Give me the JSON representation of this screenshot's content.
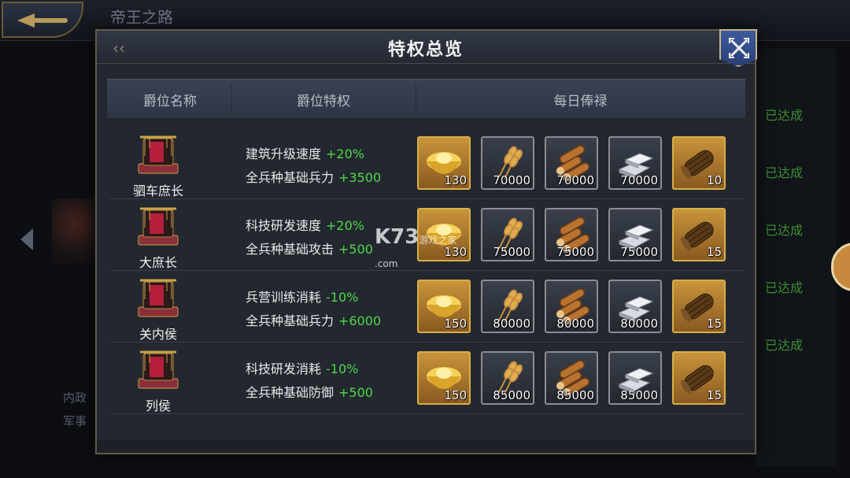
{
  "background": {
    "page_title": "帝王之路",
    "achieved_label": "已达成",
    "left_text_1": "内政",
    "left_text_2": "军事"
  },
  "dialog": {
    "title": "特权总览",
    "headers": [
      "爵位名称",
      "爵位特权",
      "每日俸禄"
    ]
  },
  "rows": [
    {
      "name": "驷车庶长",
      "privileges": [
        {
          "label": "建筑升级速度",
          "value": "+20%"
        },
        {
          "label": "全兵种基础兵力",
          "value": "+3500"
        }
      ],
      "rewards": [
        "130",
        "70000",
        "70000",
        "70000",
        "10"
      ]
    },
    {
      "name": "大庶长",
      "privileges": [
        {
          "label": "科技研发速度",
          "value": "+20%"
        },
        {
          "label": "全兵种基础攻击",
          "value": "+500"
        }
      ],
      "rewards": [
        "130",
        "75000",
        "75000",
        "75000",
        "15"
      ]
    },
    {
      "name": "关内侯",
      "privileges": [
        {
          "label": "兵营训练消耗",
          "value": "-10%"
        },
        {
          "label": "全兵种基础兵力",
          "value": "+6000"
        }
      ],
      "rewards": [
        "150",
        "80000",
        "80000",
        "80000",
        "15"
      ]
    },
    {
      "name": "列侯",
      "privileges": [
        {
          "label": "科技研发消耗",
          "value": "-10%"
        },
        {
          "label": "全兵种基础防御",
          "value": "+500"
        }
      ],
      "rewards": [
        "150",
        "85000",
        "85000",
        "85000",
        "15"
      ]
    }
  ],
  "reward_icons": [
    "gold-ingot-icon",
    "grain-icon",
    "wood-logs-icon",
    "silver-ingot-icon",
    "scroll-icon"
  ],
  "watermark": {
    "main": "K73",
    "sub": "游戏之家",
    "domain": ".com"
  },
  "colors": {
    "accent_green": "#4fd84a",
    "gold_border": "#d6b048",
    "achieved_green": "#3d8f33"
  }
}
